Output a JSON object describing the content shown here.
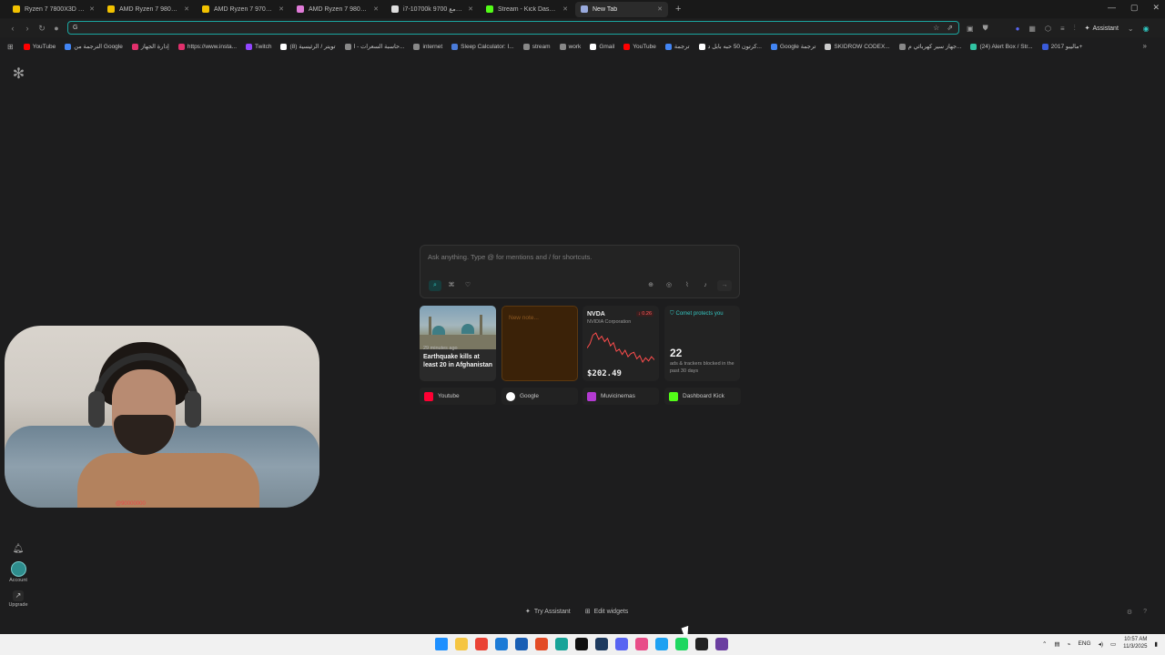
{
  "tabs": [
    {
      "label": "Ryzen 7 7800X3D - Google S",
      "color": "#f2c200"
    },
    {
      "label": "AMD Ryzen 7 9800X3D | New",
      "color": "#f2c200"
    },
    {
      "label": "AMD Ryzen 7 9700X - Ryzen",
      "color": "#f2c200"
    },
    {
      "label": "AMD Ryzen 7 9800X3D - Goo",
      "color": "#e07bd8"
    },
    {
      "label": "i7-10700k مع 9700X قارن",
      "color": "#ddd"
    },
    {
      "label": "Stream - Kick Dashboard",
      "color": "#53fc18"
    },
    {
      "label": "New Tab",
      "color": "#9ad"
    }
  ],
  "address_bar": {
    "value": ""
  },
  "toolbar": {
    "assistant_label": "Assistant"
  },
  "bookmarks": [
    {
      "label": "YouTube",
      "color": "#ff0000"
    },
    {
      "label": "الترجمة من Google",
      "color": "#4285f4"
    },
    {
      "label": "إدارة الجهاز",
      "color": "#e1306c"
    },
    {
      "label": "https://www.insta...",
      "color": "#e1306c"
    },
    {
      "label": "Twitch",
      "color": "#9146ff"
    },
    {
      "label": "(8) تويتر / الرئيسية",
      "color": "#ffffff"
    },
    {
      "label": "حاسبة السعرات - ا...",
      "color": "#888888"
    },
    {
      "label": "internet",
      "color": "#888888"
    },
    {
      "label": "Sleep Calculator: I...",
      "color": "#4a7bd9"
    },
    {
      "label": "stream",
      "color": "#888888"
    },
    {
      "label": "work",
      "color": "#888888"
    },
    {
      "label": "Gmail",
      "color": "#ffffff"
    },
    {
      "label": "YouTube",
      "color": "#ff0000"
    },
    {
      "label": "ترجمة",
      "color": "#4285f4"
    },
    {
      "label": "كرتون 50 حبه بابل د...",
      "color": "#ffffff"
    },
    {
      "label": "Google ترجمة",
      "color": "#4285f4"
    },
    {
      "label": "SKIDROW CODEX...",
      "color": "#cccccc"
    },
    {
      "label": "جهاز سير كهربائي م...",
      "color": "#888888"
    },
    {
      "label": "(24) Alert Box / Str...",
      "color": "#31c3a2"
    },
    {
      "label": "ماليبو 2017+",
      "color": "#3a5bd9"
    }
  ],
  "ask": {
    "placeholder": "Ask anything. Type @ for mentions and / for shortcuts."
  },
  "news": {
    "time": "29 minutes ago",
    "title": "Earthquake kills at least 20 in Afghanistan"
  },
  "note": {
    "placeholder": "New note..."
  },
  "stock": {
    "symbol": "NVDA",
    "name": "NVIDIA Corporation",
    "change": "↓ 0.26",
    "price": "$202.49",
    "series": [
      42,
      38,
      30,
      28,
      34,
      31,
      36,
      33,
      40,
      37,
      45,
      43,
      48,
      44,
      50,
      47,
      46,
      52,
      49,
      55,
      51,
      54,
      50,
      53
    ]
  },
  "comet": {
    "title": "Comet protects you",
    "count": "22",
    "desc": "ads & trackers blocked in the past 30 days"
  },
  "shortcuts": [
    {
      "label": "Youtube",
      "color": "#ff0033"
    },
    {
      "label": "Google",
      "color": "#ffffff"
    },
    {
      "label": "Muvicinemas",
      "color": "#b33ad1"
    },
    {
      "label": "Dashboard Kick",
      "color": "#53fc18"
    }
  ],
  "sidebar": {
    "account_label": "Account",
    "upgrade_label": "Upgrade"
  },
  "actions": {
    "try_assistant": "Try Assistant",
    "edit_widgets": "Edit widgets"
  },
  "webcam": {
    "caption": "@90000000"
  },
  "taskbar": {
    "icons": [
      "#1e90ff",
      "#f5c542",
      "#ea4335",
      "#1c7bd6",
      "#1a5fb4",
      "#e34c26",
      "#17a398",
      "#111111",
      "#1d3a5f",
      "#5865f2",
      "#e84d88",
      "#1da1f2",
      "#1ed760",
      "#222222",
      "#6b3fa0"
    ],
    "lang": "ENG",
    "time": "10:57 AM",
    "date": "11/3/2025"
  }
}
